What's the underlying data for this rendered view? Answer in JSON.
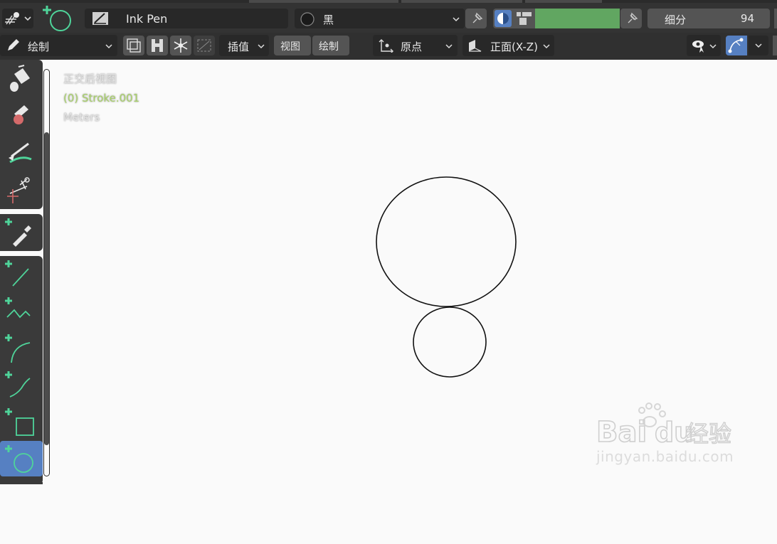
{
  "header": {
    "brush_name": "Ink Pen",
    "material": "黑",
    "subdivide_label": "细分",
    "subdivide_value": "94",
    "stroke_color": "#61a661"
  },
  "toolbar2": {
    "mode_label": "绘制",
    "interpolate_label": "插值",
    "menu_view": "视图",
    "menu_draw": "绘制",
    "origin_label": "原点",
    "orientation_label": "正面(X-Z)"
  },
  "viewport": {
    "view_name": "正交后视图",
    "object_name": "(0) Stroke.001",
    "units": "Meters"
  },
  "tools": [
    {
      "name": "fill-tool",
      "icon": "bucket-icon"
    },
    {
      "name": "erase-tool",
      "icon": "eraser-icon"
    },
    {
      "name": "tint-tool",
      "icon": "tint-brush-icon"
    },
    {
      "name": "cutter-tool",
      "icon": "scissors-icon"
    },
    {
      "name": "eyedropper-tool",
      "icon": "eyedropper-icon"
    },
    {
      "name": "line-tool",
      "icon": "line-icon"
    },
    {
      "name": "polyline-tool",
      "icon": "polyline-icon"
    },
    {
      "name": "arc-tool",
      "icon": "arc-icon"
    },
    {
      "name": "curve-tool",
      "icon": "curve-icon"
    },
    {
      "name": "box-tool",
      "icon": "box-icon"
    },
    {
      "name": "circle-tool",
      "icon": "circle-icon",
      "selected": true
    }
  ],
  "watermark": {
    "brand": "Bai",
    "brand2": "du",
    "brand_cn": "经验",
    "url": "jingyan.baidu.com"
  },
  "colors": {
    "accent": "#5680c2",
    "green_icon": "#4fd49a",
    "object_text": "#a8d069",
    "panel": "#3a3a3a"
  }
}
